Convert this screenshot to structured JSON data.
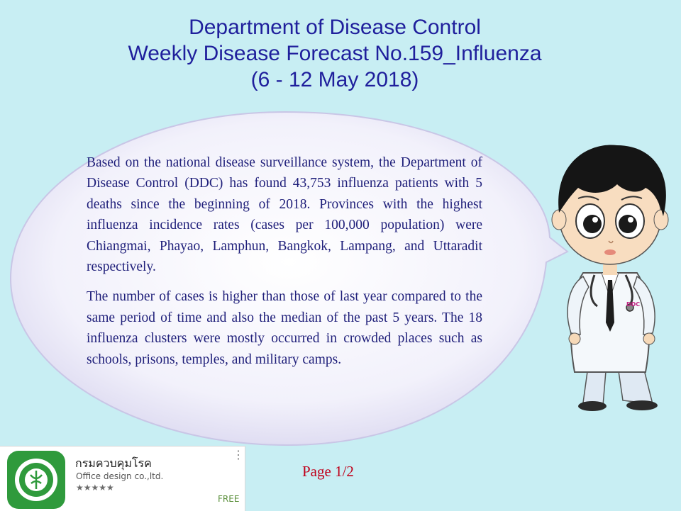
{
  "title": {
    "line1": "Department of Disease Control",
    "line2": "Weekly Disease Forecast No.159_Influenza",
    "line3": "(6 - 12 May 2018)"
  },
  "body": {
    "paragraph1": "Based on the national disease surveillance system, the Department of Disease Control (DDC) has found 43,753 influenza patients with 5 deaths since the beginning of 2018. Provinces with the highest influenza incidence rates (cases per 100,000 population) were Chiangmai, Phayao, Lamphun, Bangkok, Lampang, and Uttaradit respectively.",
    "paragraph2": "The number of cases is higher than those of last year compared to the same period of time and also the median of the past 5 years. The 18 influenza clusters were mostly occurred in crowded places such as schools, prisons, temples, and military camps."
  },
  "page_indicator": "Page 1/2",
  "app_card": {
    "name": "กรมควบคุมโรค",
    "developer": "Office design co.,ltd.",
    "rating_stars": "★★★★★",
    "price": "FREE",
    "icon": "ddc-logo-icon",
    "menu_icon": "more-vertical-icon"
  },
  "doctor": {
    "badge": "DDC"
  },
  "colors": {
    "background": "#c8eef3",
    "title": "#1f1f9c",
    "body_text": "#1f1f7a",
    "page_number": "#c0001a",
    "app_icon_green": "#2f9a3c"
  }
}
